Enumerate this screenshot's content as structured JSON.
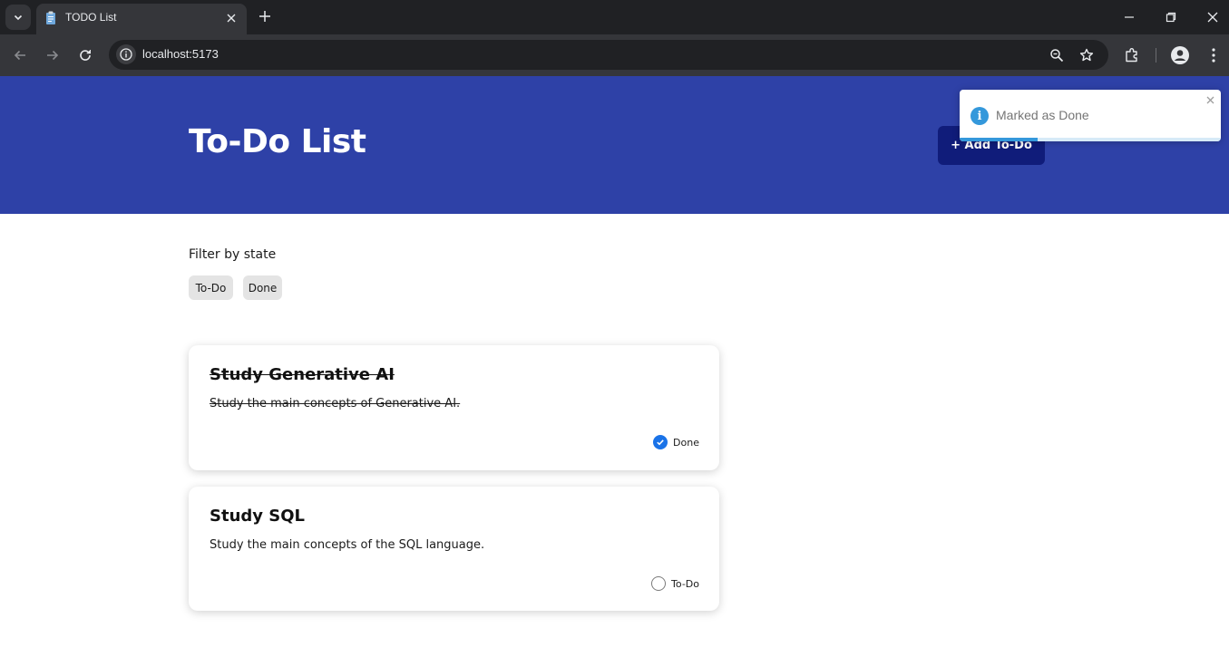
{
  "browser": {
    "tab_title": "TODO List",
    "url": "localhost:5173"
  },
  "header": {
    "title": "To-Do List",
    "add_button": "+ Add To-Do"
  },
  "filter": {
    "label": "Filter by state",
    "chips": [
      "To-Do",
      "Done"
    ]
  },
  "todos": [
    {
      "title": "Study Generative AI",
      "description": "Study the main concepts of Generative AI.",
      "state": "Done",
      "done": true
    },
    {
      "title": "Study SQL",
      "description": "Study the main concepts of the SQL language.",
      "state": "To-Do",
      "done": false
    }
  ],
  "toast": {
    "message": "Marked as Done",
    "progress": 0.3
  },
  "colors": {
    "header_bg": "#2e41a7",
    "add_button_bg": "#101c7a",
    "check_done": "#1a73e8",
    "toast_accent": "#3498db"
  }
}
